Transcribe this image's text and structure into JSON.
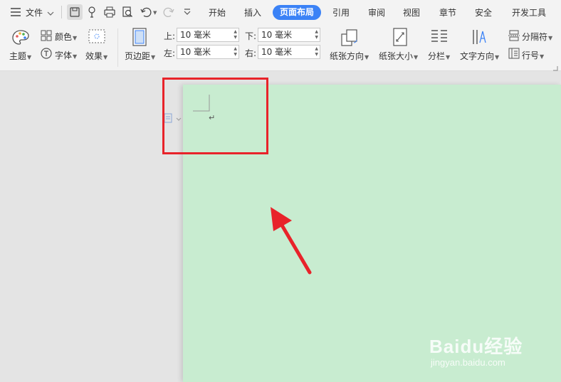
{
  "menu": {
    "file_label": "文件",
    "tabs": [
      {
        "label": "开始",
        "active": false
      },
      {
        "label": "插入",
        "active": false
      },
      {
        "label": "页面布局",
        "active": true
      },
      {
        "label": "引用",
        "active": false
      },
      {
        "label": "审阅",
        "active": false
      },
      {
        "label": "视图",
        "active": false
      },
      {
        "label": "章节",
        "active": false
      },
      {
        "label": "安全",
        "active": false
      },
      {
        "label": "开发工具",
        "active": false
      }
    ]
  },
  "ribbon": {
    "theme": "主题",
    "color": "颜色",
    "font": "字体",
    "effect": "效果",
    "margins": "页边距",
    "top_label": "上:",
    "bottom_label": "下:",
    "left_label": "左:",
    "right_label": "右:",
    "top_value": "10 毫米",
    "bottom_value": "10 毫米",
    "left_value": "10 毫米",
    "right_value": "10 毫米",
    "orientation": "纸张方向",
    "size": "纸张大小",
    "columns": "分栏",
    "text_direction": "文字方向",
    "breaks": "分隔符",
    "line_numbers": "行号"
  },
  "document": {
    "paragraph_mark": "↵"
  },
  "watermark": {
    "brand": "Baidu经验",
    "url": "jingyan.baidu.com"
  },
  "colors": {
    "page_background": "#c8ecd0",
    "active_tab": "#3b82f6",
    "annotation_red": "#e8232a"
  }
}
